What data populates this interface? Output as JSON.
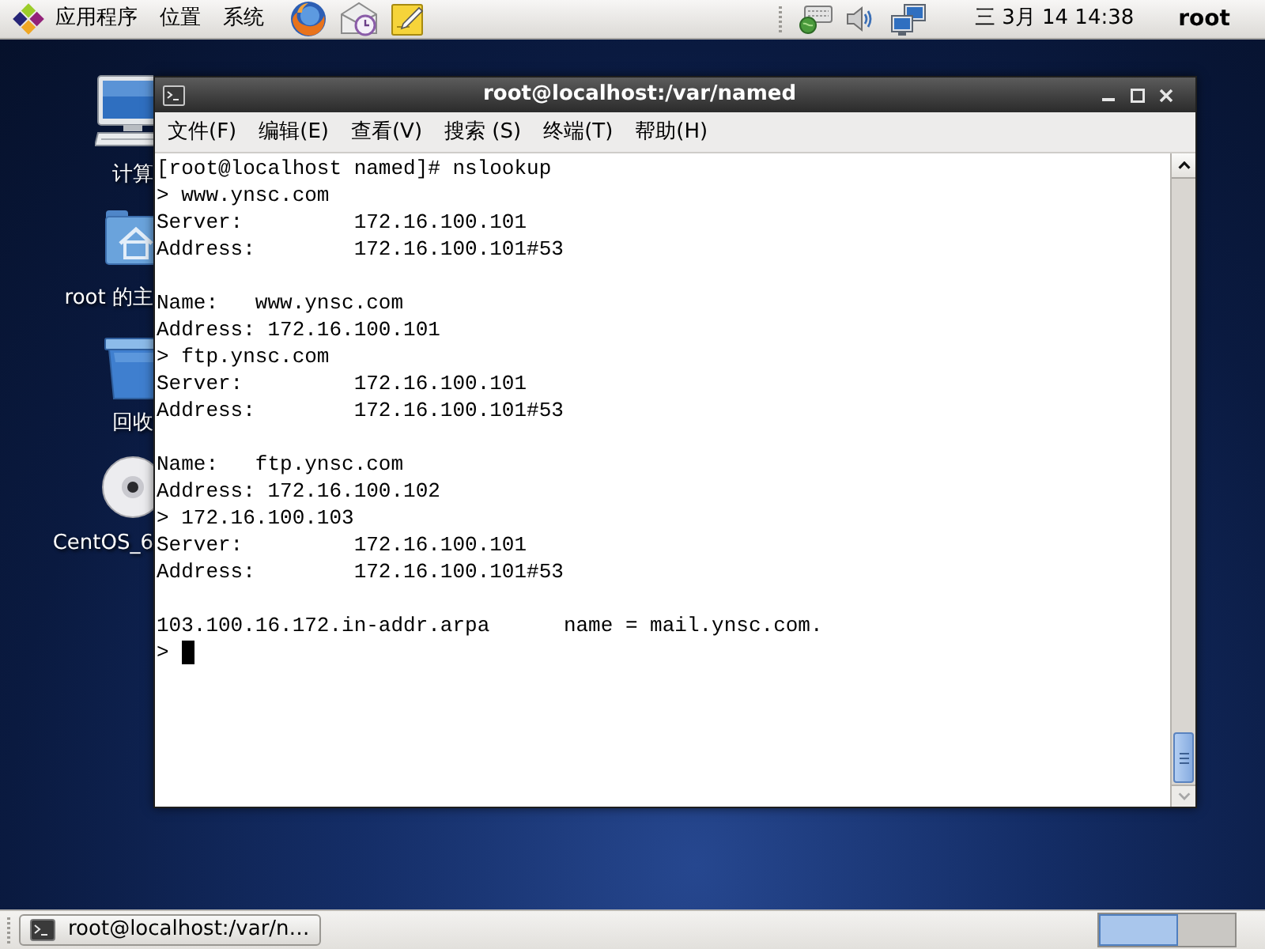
{
  "top_panel": {
    "menus": [
      "应用程序",
      "位置",
      "系统"
    ],
    "clock": "三 3月 14 14:38",
    "user": "root"
  },
  "desktop_icons": [
    {
      "kind": "computer",
      "label": "计算"
    },
    {
      "kind": "home",
      "label": "root 的主"
    },
    {
      "kind": "trash",
      "label": "回收"
    },
    {
      "kind": "disc",
      "label": "CentOS_6"
    }
  ],
  "window": {
    "title": "root@localhost:/var/named",
    "menus": [
      "文件(F)",
      "编辑(E)",
      "查看(V)",
      "搜索 (S)",
      "终端(T)",
      "帮助(H)"
    ],
    "terminal": {
      "blocks": [
        [
          "[root@localhost named]# nslookup",
          "> www.ynsc.com",
          "Server:         172.16.100.101",
          "Address:        172.16.100.101#53"
        ],
        [
          "Name:   www.ynsc.com",
          "Address: 172.16.100.101",
          "> ftp.ynsc.com",
          "Server:         172.16.100.101",
          "Address:        172.16.100.101#53"
        ],
        [
          "Name:   ftp.ynsc.com",
          "Address: 172.16.100.102",
          "> 172.16.100.103",
          "Server:         172.16.100.101",
          "Address:        172.16.100.101#53"
        ],
        [
          "103.100.16.172.in-addr.arpa      name = mail.ynsc.com.",
          ">"
        ]
      ],
      "cursor": true
    }
  },
  "taskbar": {
    "tasks": [
      "root@localhost:/var/n…"
    ],
    "workspaces": [
      {
        "selected": true
      },
      {
        "selected": false
      }
    ]
  }
}
